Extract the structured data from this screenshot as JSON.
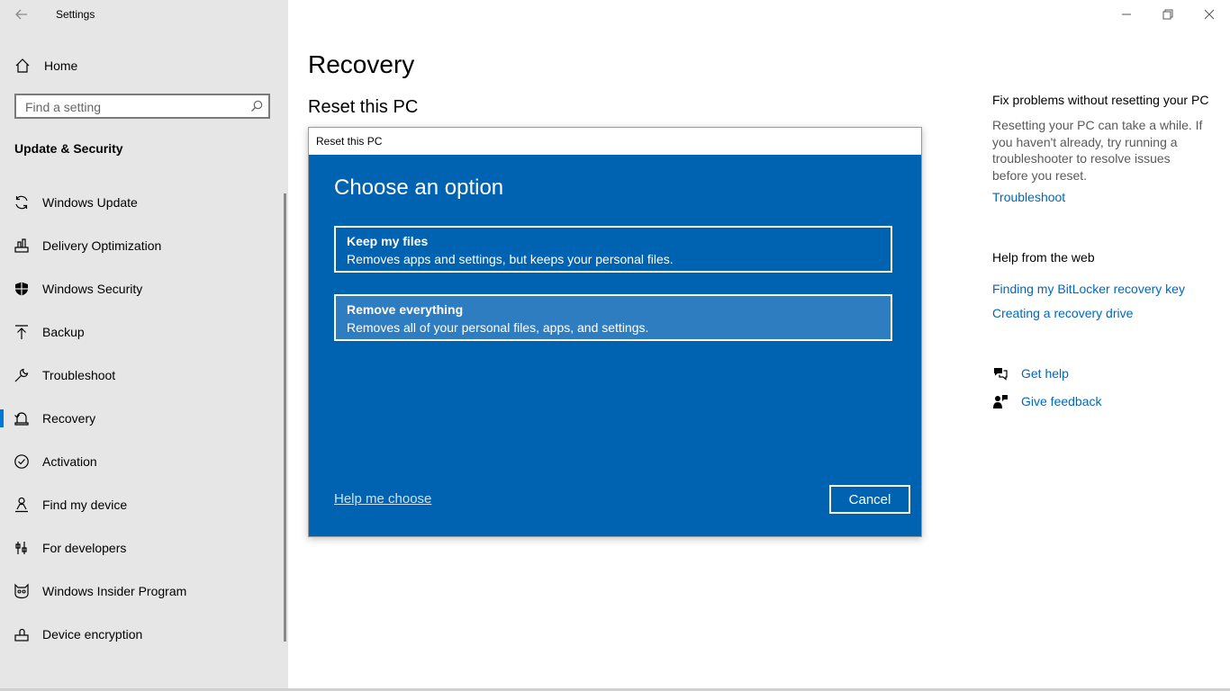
{
  "window": {
    "title": "Settings",
    "controls": [
      "minimize-icon",
      "restore-icon",
      "close-icon"
    ]
  },
  "sidebar": {
    "home_label": "Home",
    "search_placeholder": "Find a setting",
    "section_title": "Update & Security",
    "items": [
      {
        "label": "Windows Update",
        "icon": "sync-icon",
        "active": false
      },
      {
        "label": "Delivery Optimization",
        "icon": "delivery-icon",
        "active": false
      },
      {
        "label": "Windows Security",
        "icon": "shield-icon",
        "active": false
      },
      {
        "label": "Backup",
        "icon": "backup-arrow-icon",
        "active": false
      },
      {
        "label": "Troubleshoot",
        "icon": "wrench-icon",
        "active": false
      },
      {
        "label": "Recovery",
        "icon": "recovery-icon",
        "active": true
      },
      {
        "label": "Activation",
        "icon": "check-circle-icon",
        "active": false
      },
      {
        "label": "Find my device",
        "icon": "person-location-icon",
        "active": false
      },
      {
        "label": "For developers",
        "icon": "developer-tools-icon",
        "active": false
      },
      {
        "label": "Windows Insider Program",
        "icon": "insider-cat-icon",
        "active": false
      },
      {
        "label": "Device encryption",
        "icon": "encryption-icon",
        "active": false
      }
    ]
  },
  "main": {
    "page_title": "Recovery",
    "section_title": "Reset this PC"
  },
  "dialog": {
    "title": "Reset this PC",
    "heading": "Choose an option",
    "options": [
      {
        "title": "Keep my files",
        "desc": "Removes apps and settings, but keeps your personal files.",
        "selected": false
      },
      {
        "title": "Remove everything",
        "desc": "Removes all of your personal files, apps, and settings.",
        "selected": true
      }
    ],
    "help_link": "Help me choose",
    "cancel_label": "Cancel"
  },
  "right_panel": {
    "fix_title": "Fix problems without resetting your PC",
    "fix_text": "Resetting your PC can take a while. If you haven't already, try running a troubleshooter to resolve issues before you reset.",
    "troubleshoot_link": "Troubleshoot",
    "web_title": "Help from the web",
    "web_links": [
      "Finding my BitLocker recovery key",
      "Creating a recovery drive"
    ],
    "get_help": "Get help",
    "give_feedback": "Give feedback"
  },
  "colors": {
    "accent": "#0078d7",
    "dialog_bg": "#0063b1",
    "link": "#0067c0",
    "sidebar_bg": "#e6e6e6"
  }
}
